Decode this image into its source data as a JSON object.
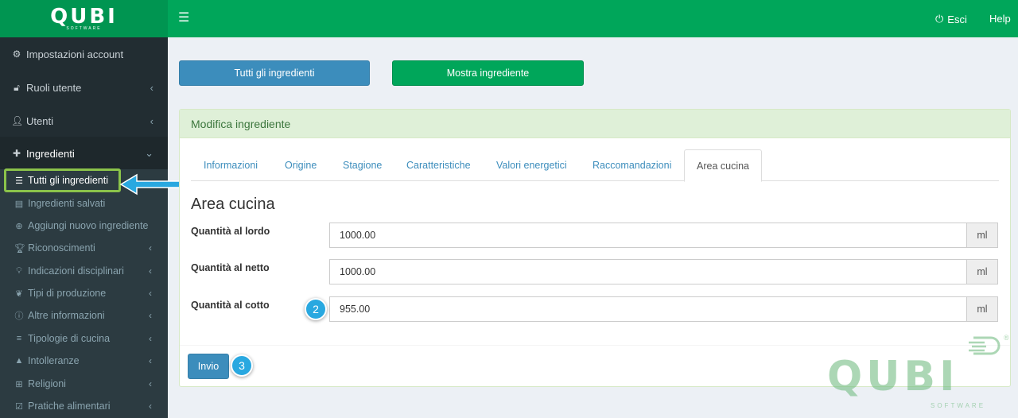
{
  "header": {
    "logo": "QUBI",
    "logo_sub": "SOFTWARE",
    "logout_label": "Esci",
    "help_label": "Help"
  },
  "sidebar": {
    "items": [
      {
        "label": "Impostazioni account",
        "icon": "gear-icon"
      },
      {
        "label": "Ruoli utente",
        "icon": "unlock-icon"
      },
      {
        "label": "Utenti",
        "icon": "user-icon"
      },
      {
        "label": "Ingredienti",
        "icon": "puzzle-icon"
      }
    ],
    "submenu": [
      {
        "label": "Tutti gli ingredienti",
        "icon": "list-icon"
      },
      {
        "label": "Ingredienti salvati",
        "icon": "archive-icon"
      },
      {
        "label": "Aggiungi nuovo ingrediente",
        "icon": "plus-circle-icon"
      },
      {
        "label": "Riconoscimenti",
        "icon": "trophy-icon"
      },
      {
        "label": "Indicazioni disciplinari",
        "icon": "lightbulb-icon"
      },
      {
        "label": "Tipi di produzione",
        "icon": "leaf-icon"
      },
      {
        "label": "Altre informazioni",
        "icon": "info-icon"
      },
      {
        "label": "Tipologie di cucina",
        "icon": "align-left-icon"
      },
      {
        "label": "Intolleranze",
        "icon": "warning-icon"
      },
      {
        "label": "Religioni",
        "icon": "plus-square-icon"
      },
      {
        "label": "Pratiche alimentari",
        "icon": "check-square-icon"
      }
    ]
  },
  "main": {
    "btn_all": "Tutti gli ingredienti",
    "btn_show": "Mostra ingrediente",
    "box_title": "Modifica ingrediente",
    "tabs": [
      {
        "label": "Informazioni"
      },
      {
        "label": "Origine"
      },
      {
        "label": "Stagione"
      },
      {
        "label": "Caratteristiche"
      },
      {
        "label": "Valori energetici"
      },
      {
        "label": "Raccomandazioni"
      },
      {
        "label": "Area cucina"
      }
    ],
    "section_title": "Area cucina",
    "fields": [
      {
        "label": "Quantità al lordo",
        "value": "1000.00",
        "unit": "ml"
      },
      {
        "label": "Quantità al netto",
        "value": "1000.00",
        "unit": "ml"
      },
      {
        "label": "Quantità al cotto",
        "value": "955.00",
        "unit": "ml"
      }
    ],
    "submit_label": "Invio"
  },
  "annotations": {
    "step2": "2",
    "step3": "3"
  },
  "watermark": {
    "text": "QUBI",
    "sub": "SOFTWARE",
    "reg": "®"
  },
  "colors": {
    "brand_green": "#00a65a",
    "sidebar_bg": "#222d32",
    "primary_blue": "#3c8dbc",
    "highlight_green": "#8bc34a",
    "callout_blue": "#29a8e0"
  }
}
